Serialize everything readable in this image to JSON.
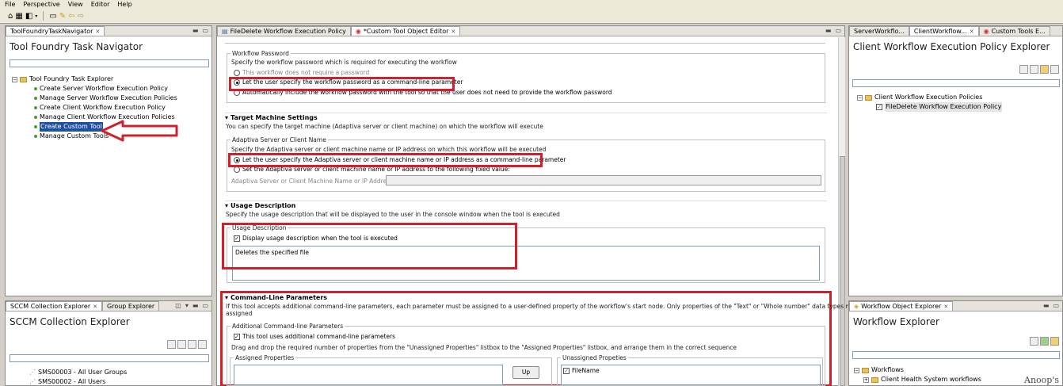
{
  "menu": [
    "File",
    "Perspective",
    "View",
    "Editor",
    "Help"
  ],
  "navigator": {
    "tab": "ToolFoundryTaskNavigator",
    "title": "Tool Foundry Task Navigator",
    "root": "Tool Foundry Task Explorer",
    "items": [
      "Create Server Workflow Execution Policy",
      "Manage Server Workflow Execution Policies",
      "Create Client Workflow Execution Policy",
      "Manage Client Workflow Execution Policies",
      "Create Custom Tool",
      "Manage Custom Tools"
    ],
    "selected_index": 4
  },
  "sccm": {
    "tabs": [
      "SCCM Collection Explorer",
      "Group Explorer"
    ],
    "title": "SCCM Collection Explorer",
    "items": [
      "SMS00003 - All User Groups",
      "SMS00002 - All Users"
    ]
  },
  "editor": {
    "tabs": [
      "FileDelete Workflow Execution Policy",
      "*Custom Tool Object Editor"
    ],
    "password": {
      "group_label": "Workflow Password",
      "desc": "Specify the workflow password which is required for executing the workflow",
      "opt1": "This workflow does not require a password",
      "opt2": "Let the user specify the workflow password as a command-line parameter",
      "opt3": "Automatically include the workflow password with the tool so that the user does not need to provide the workflow password"
    },
    "target": {
      "title": "Target Machine Settings",
      "desc": "You can specify the target machine (Adaptiva server or client machine) on which the workflow will execute",
      "group_label": "Adaptiva Server or Client Name",
      "group_desc": "Specify the Adaptiva server or client machine name or IP address on which this workflow will be executed",
      "opt1": "Let the user specify the Adaptiva server or client machine name or IP address as a command-line parameter",
      "opt2": "Set the Adaptiva server or client machine name or IP address to the following fixed value:",
      "field_label": "Adaptiva Server or Client Machine Name or IP Address:"
    },
    "usage": {
      "title": "Usage Description",
      "desc": "Specify the usage description that will be displayed to the user in the console window when the tool is executed",
      "group_label": "Usage Description",
      "check": "Display usage description when the tool is executed",
      "text": "Deletes the specified file"
    },
    "cmdline": {
      "title": "Command-Line Parameters",
      "desc1": "If this tool accepts additional command-line parameters, each parameter must be assigned to a user-defined property of the workflow's start node. Only properties of the \"Text\" or \"Whole number\" data types may be",
      "desc2": "assigned",
      "group_label": "Additional Command-line Parameters",
      "check": "This tool uses additional command-line parameters",
      "drag_desc": "Drag and drop the required number of properties from the \"Unassigned Properties\" listbox to the \"Assigned Properties\" listbox, and arrange them in the correct sequence",
      "assigned_label": "Assigned Properties",
      "unassigned_label": "Unassigned Propeties",
      "up_button": "Up",
      "unassigned_items": [
        "FileName"
      ]
    }
  },
  "client_policy": {
    "tabs": [
      "ServerWorkflo...",
      "ClientWorkflow...",
      "Custom Tools E..."
    ],
    "title": "Client Workflow Execution Policy Explorer",
    "root": "Client Workflow Execution Policies",
    "child": "FileDelete Workflow Execution Policy"
  },
  "workflow": {
    "tab": "Workflow Object Explorer",
    "title": "Workflow Explorer",
    "root": "Workflows",
    "child": "Client Health System workflows"
  },
  "watermark": "Anoop's",
  "colors": {
    "highlight": "#d11f2b",
    "selection": "#1f4fa0"
  }
}
